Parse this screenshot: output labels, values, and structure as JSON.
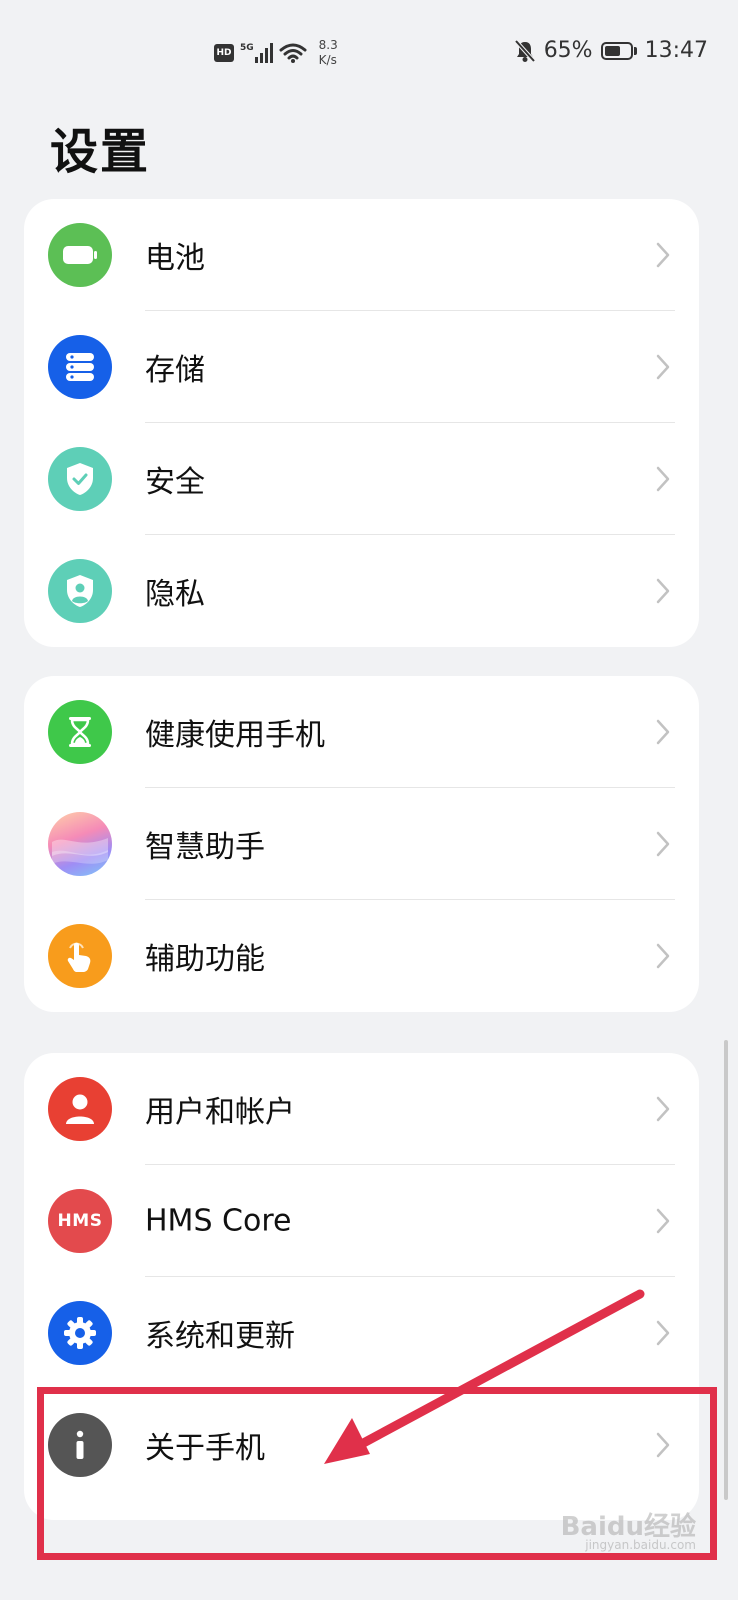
{
  "status_bar": {
    "hd": "HD",
    "network": "5G",
    "speed_value": "8.3",
    "speed_unit": "K/s",
    "battery": "65%",
    "battery_level": 0.65,
    "time": "13:47"
  },
  "page": {
    "title": "设置"
  },
  "groups": [
    {
      "items": [
        {
          "label": "电池",
          "icon": "battery-icon",
          "color": "#5cbf55"
        },
        {
          "label": "存储",
          "icon": "storage-icon",
          "color": "#1660e8"
        },
        {
          "label": "安全",
          "icon": "shield-check-icon",
          "color": "#5ecfb7"
        },
        {
          "label": "隐私",
          "icon": "privacy-shield-icon",
          "color": "#5ecfb7"
        }
      ]
    },
    {
      "items": [
        {
          "label": "健康使用手机",
          "icon": "hourglass-icon",
          "color": "#3fc84a"
        },
        {
          "label": "智慧助手",
          "icon": "assistant-icon",
          "color": "gradient"
        },
        {
          "label": "辅助功能",
          "icon": "hand-icon",
          "color": "#f89c1c"
        }
      ]
    },
    {
      "items": [
        {
          "label": "用户和帐户",
          "icon": "user-icon",
          "color": "#e84033"
        },
        {
          "label": "HMS Core",
          "icon": "hms-icon",
          "color": "#e34a4d",
          "icon_text": "HMS"
        },
        {
          "label": "系统和更新",
          "icon": "gear-icon",
          "color": "#1660e8"
        },
        {
          "label": "关于手机",
          "icon": "info-icon",
          "color": "#555555"
        }
      ]
    }
  ],
  "annotation": {
    "highlight_color": "#e0304a"
  },
  "watermark": {
    "brand": "Baidu经验",
    "url": "jingyan.baidu.com"
  }
}
